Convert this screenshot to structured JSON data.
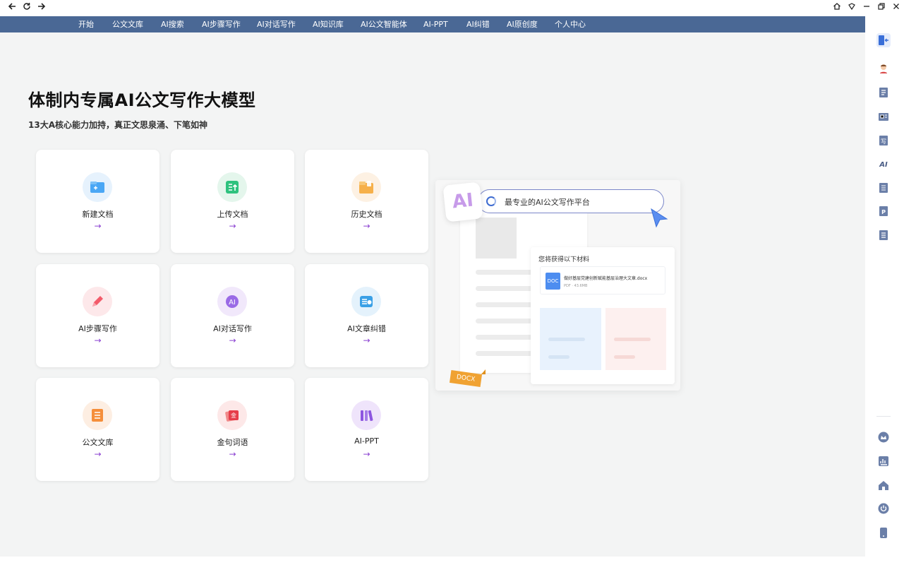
{
  "browser": {
    "back_glyph": "🡐",
    "reload_glyph": "⟳",
    "forward_glyph": "🡒",
    "home_glyph": "⌂",
    "minimize_glyph": "–",
    "restore_glyph": "❐",
    "close_glyph": "✕"
  },
  "nav": {
    "items": [
      "开始",
      "公文文库",
      "AI搜索",
      "AI步骤写作",
      "AI对话写作",
      "AI知识库",
      "AI公文智能体",
      "AI-PPT",
      "AI纠错",
      "AI原创度",
      "个人中心"
    ]
  },
  "hero": {
    "title": "体制内专属AI公文写作大模型",
    "subtitle": "13大A核心能力加持，真正文思泉涌、下笔如神"
  },
  "cards": [
    {
      "label": "新建文档",
      "arrow": "→",
      "icon": "new-document-icon"
    },
    {
      "label": "上传文档",
      "arrow": "→",
      "icon": "upload-document-icon"
    },
    {
      "label": "历史文档",
      "arrow": "→",
      "icon": "history-folder-icon"
    },
    {
      "label": "AI步骤写作",
      "arrow": "→",
      "icon": "pen-icon"
    },
    {
      "label": "AI对话写作",
      "arrow": "→",
      "icon": "ai-chat-icon"
    },
    {
      "label": "AI文章纠错",
      "arrow": "→",
      "icon": "proofread-icon"
    },
    {
      "label": "公文文库",
      "arrow": "→",
      "icon": "library-icon"
    },
    {
      "label": "金句词语",
      "arrow": "→",
      "icon": "golden-quote-icon"
    },
    {
      "label": "AI-PPT",
      "arrow": "→",
      "icon": "ppt-icon"
    }
  ],
  "illustration": {
    "ai_badge": "AI",
    "search_text": "最专业的AI公文写作平台",
    "materials_title": "您将获得以下材料",
    "file_icon": "DOC",
    "file_name": "做好基层党建创新赋能基层治理大文章.docx",
    "file_meta": "PDF · 43.6MB",
    "docx_tag": "DOCX"
  },
  "rightbar": {
    "icons": [
      "sidebar-toggle-icon",
      "user-avatar-icon",
      "document-icon",
      "news-icon",
      "write-icon",
      "ai-icon",
      "book-icon",
      "ppt-icon",
      "list-icon",
      "crown-icon",
      "chart-icon",
      "home-icon",
      "power-icon",
      "phone-icon"
    ]
  },
  "colors": {
    "nav_bg": "#4a6895",
    "accent_arrow": "#8a3fd1",
    "background": "#f3f4f4"
  }
}
